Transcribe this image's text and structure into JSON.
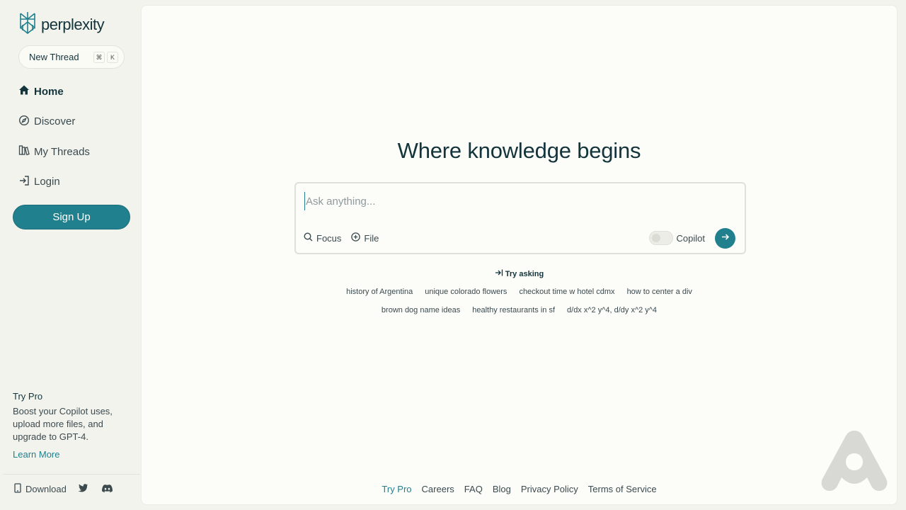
{
  "sidebar": {
    "logo_text": "perplexity",
    "new_thread": {
      "label": "New Thread",
      "kbd_cmd": "⌘",
      "kbd_key": "K"
    },
    "nav": [
      {
        "label": "Home",
        "icon": "home-icon",
        "active": true
      },
      {
        "label": "Discover",
        "icon": "compass-icon"
      },
      {
        "label": "My Threads",
        "icon": "library-icon"
      },
      {
        "label": "Login",
        "icon": "login-icon"
      }
    ],
    "signup_label": "Sign Up",
    "pro": {
      "title": "Try Pro",
      "body": "Boost your Copilot uses, upload more files, and upgrade to GPT-4.",
      "link": "Learn More"
    },
    "footer": {
      "download": "Download"
    }
  },
  "main": {
    "headline": "Where knowledge begins",
    "search": {
      "placeholder": "Ask anything...",
      "focus_label": "Focus",
      "file_label": "File",
      "copilot_label": "Copilot"
    },
    "try_asking": "Try asking",
    "suggestions_row1": [
      "history of Argentina",
      "unique colorado flowers",
      "checkout time w hotel cdmx",
      "how to center a div"
    ],
    "suggestions_row2": [
      "brown dog name ideas",
      "healthy restaurants in sf",
      "d/dx x^2 y^4, d/dy x^2 y^4"
    ],
    "footer_links": [
      "Try Pro",
      "Careers",
      "FAQ",
      "Blog",
      "Privacy Policy",
      "Terms of Service"
    ]
  },
  "colors": {
    "accent": "#20808d",
    "text": "#13343b",
    "background": "#f3f3ee",
    "panel": "#fcfcf9"
  }
}
